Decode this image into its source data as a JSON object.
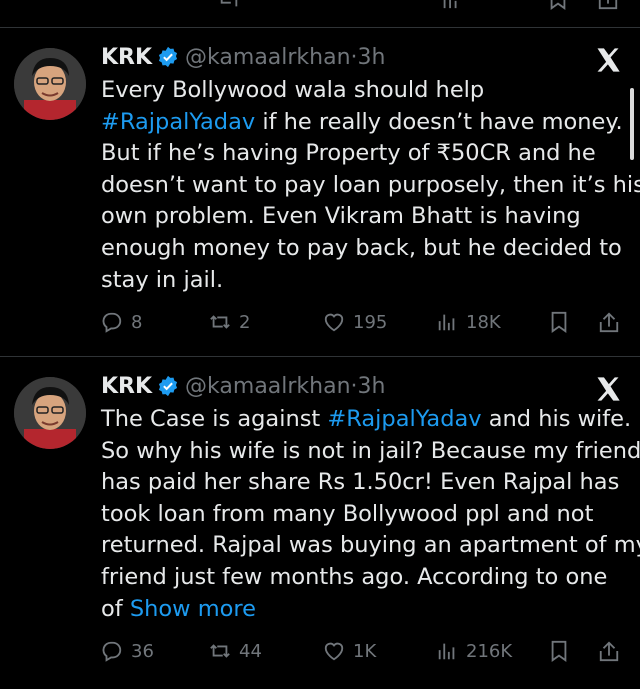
{
  "tweets": [
    {
      "name": "KRK",
      "handle": "@kamaalrkhan",
      "dot": "·",
      "time": "3h",
      "lines": [
        [
          "Every Bollywood wala should help"
        ],
        [
          "#RajpalYadav",
          " if he really doesn’t have money."
        ],
        [
          "But if he’s having Property of ₹50CR and he"
        ],
        [
          "doesn’t want to pay loan purposely, then it’s his"
        ],
        [
          "own problem. Even Vikram Bhatt is having"
        ],
        [
          "enough money to pay back, but he decided to"
        ],
        [
          "stay in jail."
        ]
      ],
      "replies": "8",
      "retweets": "2",
      "likes": "195",
      "views": "18K"
    },
    {
      "name": "KRK",
      "handle": "@kamaalrkhan",
      "dot": "·",
      "time": "3h",
      "lines": [
        [
          "The Case is against ",
          "#RajpalYadav",
          " and his wife."
        ],
        [
          "So why his wife is not in jail? Because my friend"
        ],
        [
          "has paid her share Rs 1.50cr! Even Rajpal has"
        ],
        [
          "took loan from many Bollywood ppl and not"
        ],
        [
          "returned. Rajpal was buying an apartment of my"
        ],
        [
          "friend just few months ago. According to one"
        ],
        [
          "of ",
          "Show more"
        ]
      ],
      "replies": "36",
      "retweets": "44",
      "likes": "1K",
      "views": "216K"
    }
  ],
  "colors": {
    "accent": "#1d9bf0",
    "muted": "#71767b",
    "text": "#e7e9ea",
    "divider": "#2f3336"
  },
  "icons": [
    "verified-badge-icon",
    "x-logo-icon",
    "reply-icon",
    "retweet-icon",
    "like-icon",
    "views-icon",
    "bookmark-icon",
    "share-icon"
  ]
}
